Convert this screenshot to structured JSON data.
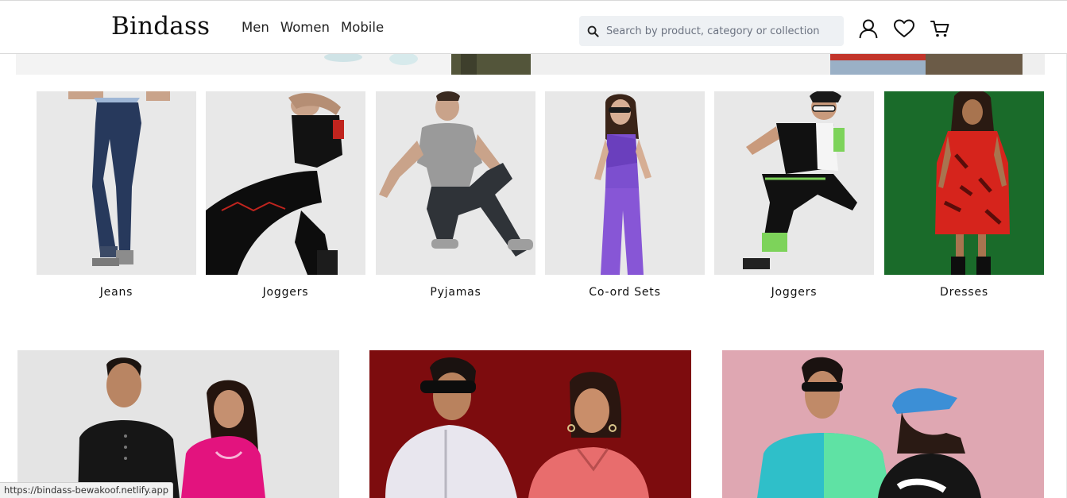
{
  "header": {
    "logo": "Bindass",
    "nav": [
      "Men",
      "Women",
      "Mobile"
    ],
    "search_placeholder": "Search by product, category or collection",
    "icons": [
      "user-icon",
      "heart-icon",
      "cart-icon"
    ]
  },
  "categories": [
    {
      "label": "Jeans"
    },
    {
      "label": "Joggers"
    },
    {
      "label": "Pyjamas"
    },
    {
      "label": "Co-ord Sets"
    },
    {
      "label": "Joggers"
    },
    {
      "label": "Dresses"
    }
  ],
  "status_url": "https://bindass-bewakoof.netlify.app",
  "colors": {
    "card_bg": "#e8e8e8",
    "dresses_bg": "#1a6b2a",
    "promo_1_bg": "#e4e4e4",
    "promo_2_bg": "#7d0c0e",
    "promo_3_bg": "#dfa7b2"
  }
}
